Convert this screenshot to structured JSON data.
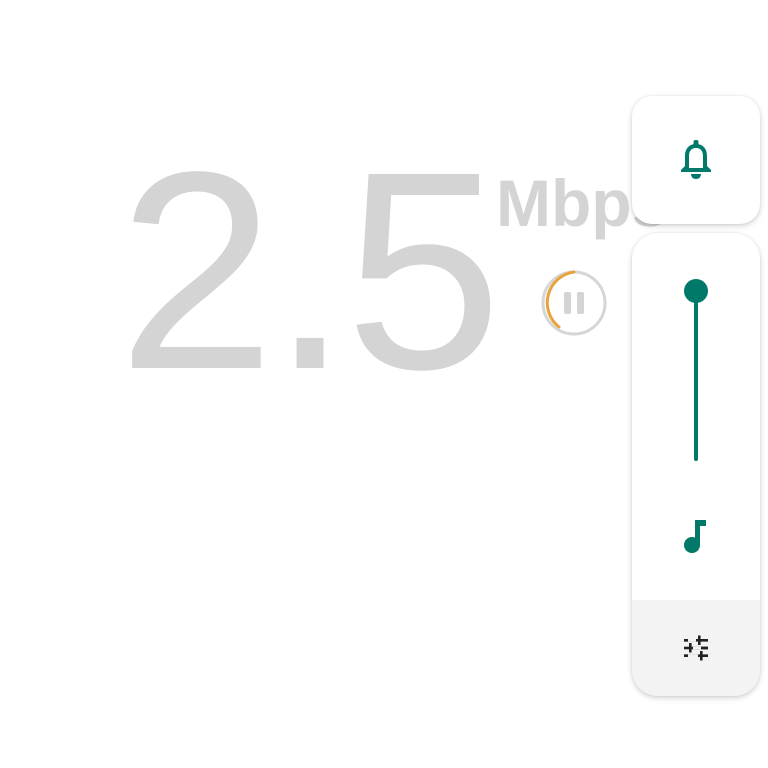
{
  "speed_meter": {
    "value": "2.5",
    "unit": "Mbps",
    "state": "paused",
    "pause_icon": "pause-icon"
  },
  "volume_panel": {
    "ringer": {
      "icon": "bell-icon",
      "mode": "ring"
    },
    "media": {
      "icon": "music-note-icon",
      "level": 1.0
    },
    "settings": {
      "icon": "tune-icon"
    }
  },
  "colors": {
    "accent": "#00796b",
    "speed_text": "#d4d4d4",
    "pause_ring": "#e8a33c",
    "pause_ring_track": "#d6d6d6",
    "settings_bg": "#f3f3f3"
  }
}
